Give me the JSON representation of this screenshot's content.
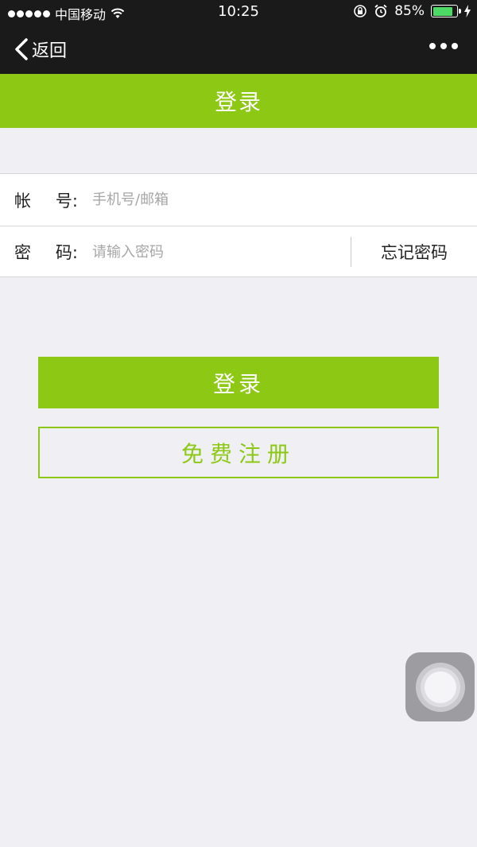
{
  "status_bar": {
    "carrier": "中国移动",
    "time": "10:25",
    "battery_percent": "85%",
    "battery_level": 0.85,
    "signal_bars": 5
  },
  "nav": {
    "back_label": "返回",
    "more_icon": "more-dots-icon"
  },
  "page_header": {
    "title": "登录"
  },
  "form": {
    "account_label_1": "帐",
    "account_label_2": "号:",
    "account_placeholder": "手机号/邮箱",
    "account_value": "",
    "password_label_1": "密",
    "password_label_2": "码:",
    "password_placeholder": "请输入密码",
    "password_value": "",
    "forgot_label": "忘记密码"
  },
  "buttons": {
    "login_label": "登录",
    "register_label": "免费注册"
  },
  "colors": {
    "accent": "#8cc814",
    "nav_bg": "#1a1a1a",
    "page_bg": "#efeff4"
  }
}
